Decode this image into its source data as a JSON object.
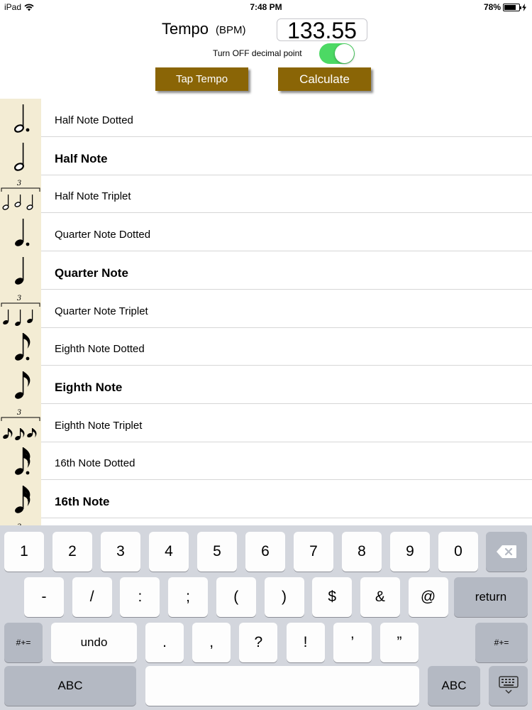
{
  "status_bar": {
    "device": "iPad",
    "time": "7:48 PM",
    "battery": "78%",
    "battery_fill": 0.78
  },
  "header": {
    "tempo_label": "Tempo",
    "tempo_unit": "(BPM)",
    "tempo_value": "133.55",
    "decimal_toggle_label": "Turn OFF decimal point",
    "decimal_toggle_on": true,
    "tap_tempo_label": "Tap Tempo",
    "calculate_label": "Calculate"
  },
  "notes": [
    {
      "label": "Half Note Dotted",
      "bold": false,
      "icon": "half-note-dotted-icon"
    },
    {
      "label": "Half Note",
      "bold": true,
      "icon": "half-note-icon"
    },
    {
      "label": "Half Note Triplet",
      "bold": false,
      "icon": "half-note-triplet-icon"
    },
    {
      "label": "Quarter Note Dotted",
      "bold": false,
      "icon": "quarter-note-dotted-icon"
    },
    {
      "label": "Quarter Note",
      "bold": true,
      "icon": "quarter-note-icon"
    },
    {
      "label": "Quarter Note Triplet",
      "bold": false,
      "icon": "quarter-note-triplet-icon"
    },
    {
      "label": "Eighth Note Dotted",
      "bold": false,
      "icon": "eighth-note-dotted-icon"
    },
    {
      "label": "Eighth Note",
      "bold": true,
      "icon": "eighth-note-icon"
    },
    {
      "label": "Eighth Note Triplet",
      "bold": false,
      "icon": "eighth-note-triplet-icon"
    },
    {
      "label": "16th Note Dotted",
      "bold": false,
      "icon": "sixteenth-note-dotted-icon"
    },
    {
      "label": "16th Note",
      "bold": true,
      "icon": "sixteenth-note-icon"
    },
    {
      "label": "",
      "bold": false,
      "icon": "sixteenth-note-triplet-icon"
    }
  ],
  "triplet_number": "3",
  "keyboard": {
    "row1": [
      "1",
      "2",
      "3",
      "4",
      "5",
      "6",
      "7",
      "8",
      "9",
      "0"
    ],
    "row2": [
      "-",
      "/",
      ":",
      ";",
      "(",
      ")",
      "$",
      "&",
      "@"
    ],
    "return_label": "return",
    "row3": [
      ".",
      ",",
      "?",
      "!",
      "’",
      "”"
    ],
    "symbols_label": "#+=",
    "undo_label": "undo",
    "abc_label": "ABC"
  },
  "colors": {
    "accent_button": "#8a6506",
    "toggle_on": "#4cd964",
    "icon_strip": "#f3ecd4",
    "keyboard_bg": "#d3d6dd"
  }
}
